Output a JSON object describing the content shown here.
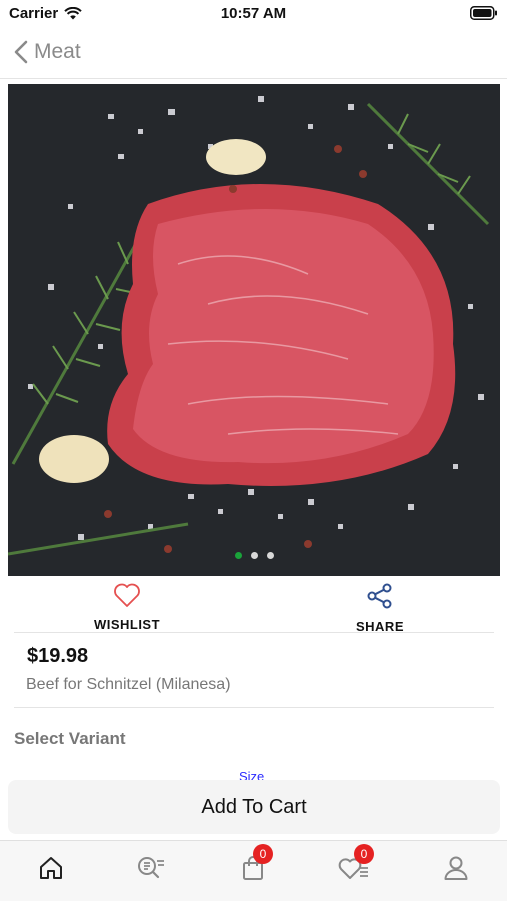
{
  "status_bar": {
    "carrier": "Carrier",
    "time": "10:57 AM"
  },
  "nav": {
    "back_label": "Meat"
  },
  "product": {
    "image": {
      "description_icon": "steak-image",
      "dot_count": 3,
      "active_dot": 0
    },
    "price": "$19.98",
    "name": "Beef for Schnitzel (Milanesa)"
  },
  "actions": {
    "wishlist_label": "WISHLIST",
    "share_label": "SHARE"
  },
  "variant": {
    "title": "Select Variant",
    "size_label": "Size"
  },
  "cart": {
    "add_label": "Add To Cart"
  },
  "tab_bar": {
    "items": [
      {
        "name": "home",
        "icon": "home-icon"
      },
      {
        "name": "search",
        "icon": "search-list-icon"
      },
      {
        "name": "cart",
        "icon": "bag-icon",
        "badge": "0"
      },
      {
        "name": "wishlist",
        "icon": "heart-list-icon",
        "badge": "0"
      },
      {
        "name": "profile",
        "icon": "user-icon"
      }
    ]
  },
  "colors": {
    "accent_red": "#e52222",
    "share_blue": "#2f4f8f",
    "dot_active": "#1aa33a"
  }
}
